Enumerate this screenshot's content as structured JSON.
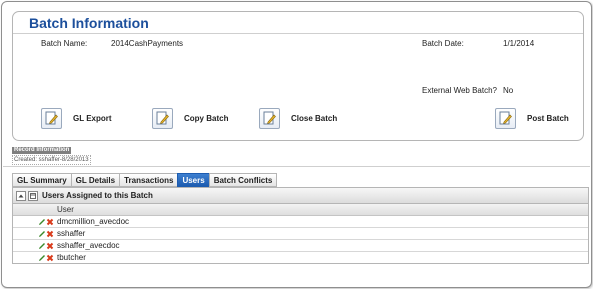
{
  "panel": {
    "title": "Batch Information"
  },
  "fields": {
    "batch_name_label": "Batch Name:",
    "batch_name_value": "2014CashPayments",
    "batch_date_label": "Batch Date:",
    "batch_date_value": "1/1/2014",
    "external_web_batch_label": "External Web Batch?",
    "external_web_batch_value": "No"
  },
  "actions": {
    "gl_export": "GL Export",
    "copy_batch": "Copy Batch",
    "close_batch": "Close Batch",
    "post_batch": "Post Batch"
  },
  "record": {
    "header": "Record Information",
    "created": "Created: sshaffer-8/28/2013"
  },
  "tabs": [
    "GL Summary",
    "GL Details",
    "Transactions",
    "Users",
    "Batch Conflicts"
  ],
  "active_tab": "Users",
  "grid": {
    "title": "Users Assigned to this Batch",
    "column": "User",
    "rows": [
      "dmcmillion_avecdoc",
      "sshaffer",
      "sshaffer_avecdoc",
      "tbutcher"
    ]
  },
  "colors": {
    "accent": "#1c4f9c",
    "tab_active": "#1d5cb0",
    "edit": "#3a8a2a",
    "delete": "#d93a1a"
  }
}
